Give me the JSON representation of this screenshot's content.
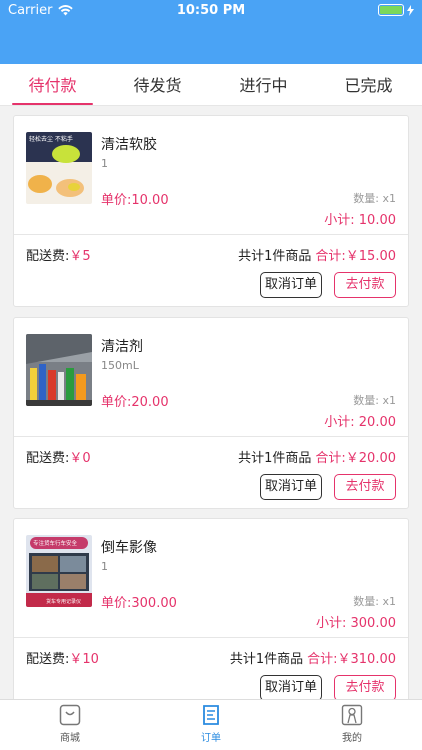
{
  "status": {
    "carrier": "Carrier",
    "time": "10:50 PM"
  },
  "tabs": [
    {
      "label": "待付款",
      "active": true
    },
    {
      "label": "待发货",
      "active": false
    },
    {
      "label": "进行中",
      "active": false
    },
    {
      "label": "已完成",
      "active": false
    }
  ],
  "orders": [
    {
      "name": "清洁软胶",
      "spec": "1",
      "unit_price": "单价:10.00",
      "qty": "数量: x1",
      "subtotal": "小计: 10.00",
      "shipping_label": "配送费:",
      "shipping_value": "￥5",
      "count_text": "共计1件商品",
      "total_label": "合计:",
      "total_value": "￥15.00",
      "cancel_label": "取消订单",
      "pay_label": "去付款",
      "thumb_caption": "轻松去尘 不粘手"
    },
    {
      "name": "清洁剂",
      "spec": "150mL",
      "unit_price": "单价:20.00",
      "qty": "数量: x1",
      "subtotal": "小计: 20.00",
      "shipping_label": "配送费:",
      "shipping_value": "￥0",
      "count_text": "共计1件商品",
      "total_label": "合计:",
      "total_value": "￥20.00",
      "cancel_label": "取消订单",
      "pay_label": "去付款",
      "thumb_caption": ""
    },
    {
      "name": "倒车影像",
      "spec": "1",
      "unit_price": "单价:300.00",
      "qty": "数量: x1",
      "subtotal": "小计: 300.00",
      "shipping_label": "配送费:",
      "shipping_value": "￥10",
      "count_text": "共计1件商品",
      "total_label": "合计:",
      "total_value": "￥310.00",
      "cancel_label": "取消订单",
      "pay_label": "去付款",
      "thumb_caption": "专注货车行车安全",
      "thumb_badge": "货车专用记录仪"
    }
  ],
  "bottom_nav": [
    {
      "label": "商城",
      "icon": "shop-icon",
      "active": false
    },
    {
      "label": "订单",
      "icon": "order-icon",
      "active": true
    },
    {
      "label": "我的",
      "icon": "profile-icon",
      "active": false
    }
  ],
  "colors": {
    "accent": "#e5336b",
    "header": "#4aa3f5",
    "nav_active": "#2a8be0"
  }
}
